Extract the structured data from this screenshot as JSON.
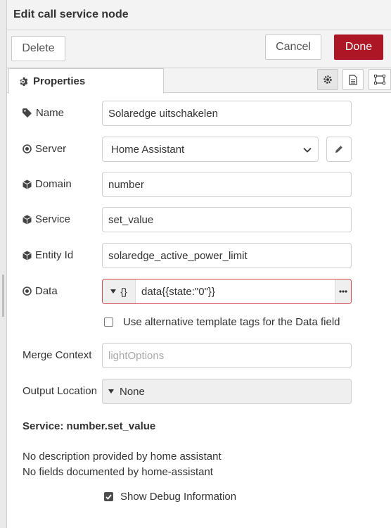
{
  "dialog": {
    "title": "Edit call service node"
  },
  "toolbar": {
    "delete_label": "Delete",
    "cancel_label": "Cancel",
    "done_label": "Done"
  },
  "tabs": {
    "properties_label": "Properties"
  },
  "form": {
    "name": {
      "label": "Name",
      "value": "Solaredge uitschakelen"
    },
    "server": {
      "label": "Server",
      "value": "Home Assistant"
    },
    "domain": {
      "label": "Domain",
      "value": "number"
    },
    "service": {
      "label": "Service",
      "value": "set_value"
    },
    "entity_id": {
      "label": "Entity Id",
      "value": "solaredge_active_power_limit"
    },
    "data": {
      "label": "Data",
      "type_symbol": "{}",
      "value": "data{{state:\"0\"}}"
    },
    "alt_tags": {
      "label": "Use alternative template tags for the Data field",
      "checked": false
    },
    "merge_context": {
      "label": "Merge Context",
      "placeholder": "lightOptions"
    },
    "output_location": {
      "label": "Output Location",
      "value": "None"
    }
  },
  "info": {
    "service_title": "Service: number.set_value",
    "line1": "No description provided by home assistant",
    "line2": "No fields documented by home-assistant"
  },
  "debug": {
    "label": "Show Debug Information",
    "checked": true
  },
  "colors": {
    "done_bg": "#ad1625",
    "error_border": "#d6464f"
  }
}
